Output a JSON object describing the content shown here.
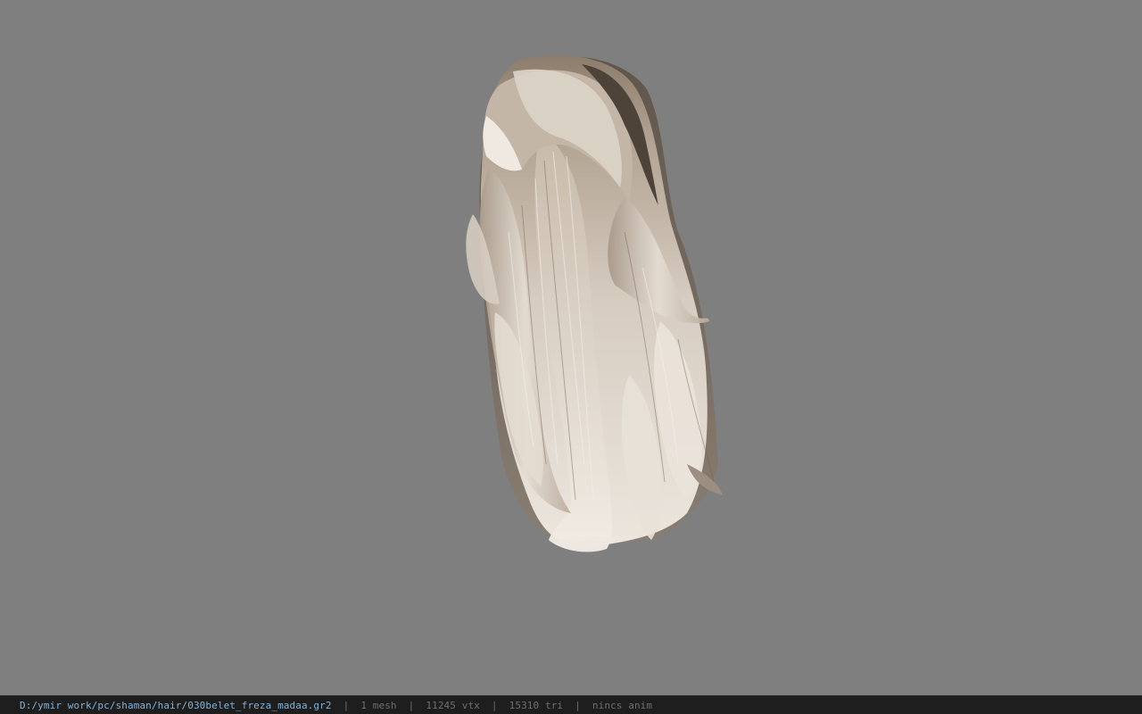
{
  "viewport": {
    "background_color": "#7f7f7f",
    "model_subject": "hair-mesh",
    "hair_colors": {
      "light": "#e8e0d6",
      "mid": "#c9bcae",
      "dark": "#6d6154",
      "root": "#8a7a69"
    }
  },
  "statusbar": {
    "file_path": "D:/ymir work/pc/shaman/hair/030belet_freza_madaa.gr2",
    "separator": "|",
    "mesh_count": "1 mesh",
    "vertex_count": "11245 vtx",
    "triangle_count": "15310 tri",
    "anim_status": "nincs anim",
    "colors": {
      "background": "#1e1e1e",
      "path": "#7fb2d9",
      "info": "#6f6f6f"
    }
  }
}
